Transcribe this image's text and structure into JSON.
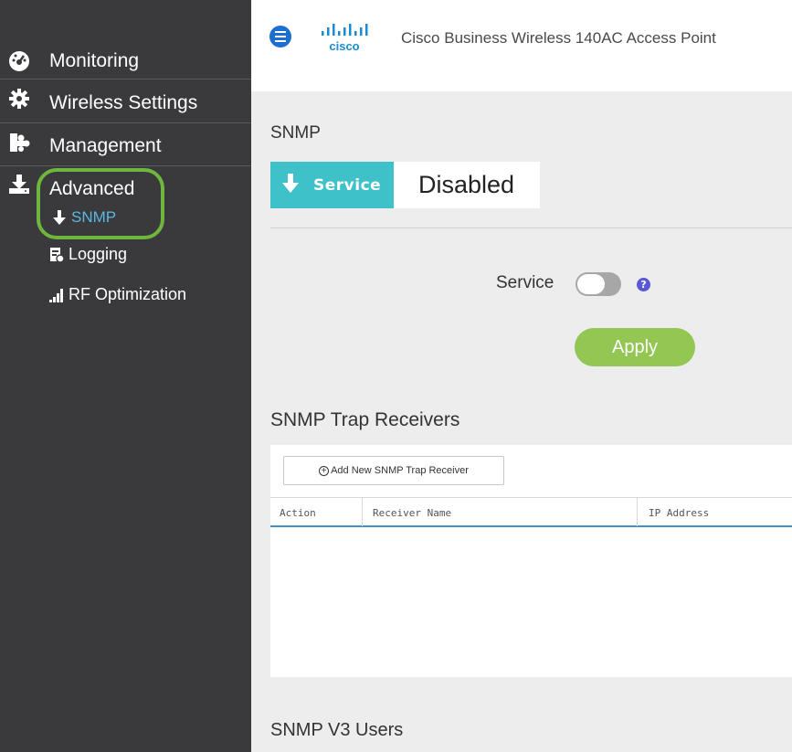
{
  "sidebar": {
    "items": [
      {
        "label": "Monitoring",
        "icon": "dashboard-icon"
      },
      {
        "label": "Wireless Settings",
        "icon": "gear-icon"
      },
      {
        "label": "Management",
        "icon": "management-icon"
      },
      {
        "label": "Advanced",
        "icon": "download-icon"
      }
    ],
    "subitems": [
      {
        "label": "SNMP",
        "icon": "arrow-down-icon",
        "active": true
      },
      {
        "label": "Logging",
        "icon": "log-file-icon"
      },
      {
        "label": "RF Optimization",
        "icon": "signal-bars-icon"
      }
    ]
  },
  "header": {
    "logo_text": "cisco",
    "title": "Cisco Business Wireless 140AC Access Point"
  },
  "snmp": {
    "section_title": "SNMP",
    "service_tag": "Service",
    "status": "Disabled",
    "service_label": "Service",
    "help": "?",
    "apply_label": "Apply"
  },
  "trap_receivers": {
    "title": "SNMP Trap Receivers",
    "add_label": "Add New SNMP Trap Receiver",
    "columns": [
      "Action",
      "Receiver Name",
      "IP Address"
    ]
  },
  "v3_users": {
    "title": "SNMP V3 Users"
  },
  "colors": {
    "sidebar_bg": "#3a3a3c",
    "accent_teal": "#3ec1c8",
    "apply_green": "#93c653",
    "highlight_ring": "#6fb63e",
    "active_link": "#5ab8e6",
    "menu_blue": "#1c6fd1"
  }
}
